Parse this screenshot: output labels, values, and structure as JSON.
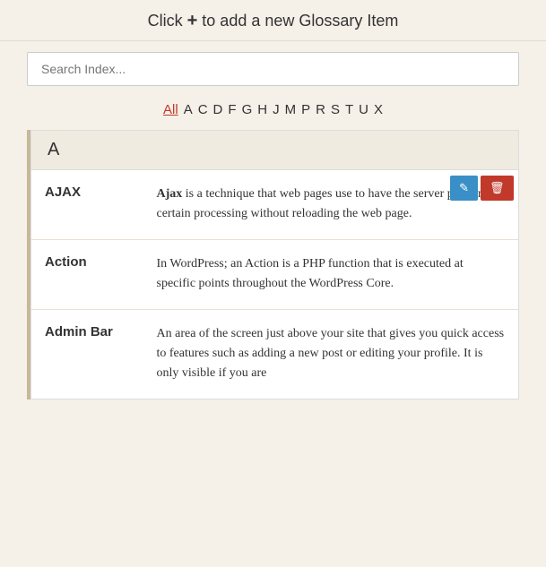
{
  "header": {
    "title_prefix": "Click",
    "title_plus": "+",
    "title_suffix": " to add a new Glossary Item"
  },
  "search": {
    "placeholder": "Search Index..."
  },
  "alphabet": {
    "items": [
      {
        "label": "All",
        "active": true
      },
      {
        "label": "A",
        "active": false
      },
      {
        "label": "C",
        "active": false
      },
      {
        "label": "D",
        "active": false
      },
      {
        "label": "F",
        "active": false
      },
      {
        "label": "G",
        "active": false
      },
      {
        "label": "H",
        "active": false
      },
      {
        "label": "J",
        "active": false
      },
      {
        "label": "M",
        "active": false
      },
      {
        "label": "P",
        "active": false
      },
      {
        "label": "R",
        "active": false
      },
      {
        "label": "S",
        "active": false
      },
      {
        "label": "T",
        "active": false
      },
      {
        "label": "U",
        "active": false
      },
      {
        "label": "X",
        "active": false
      }
    ]
  },
  "glossary": {
    "sections": [
      {
        "letter": "A",
        "entries": [
          {
            "term": "AJAX",
            "definition_bold": "Ajax",
            "definition_rest": " is a technique that web pages use to have the server perform certain processing without reloading the web page."
          },
          {
            "term": "Action",
            "definition_bold": "",
            "definition_rest": "In WordPress; an Action is a PHP function that is executed at specific points throughout the WordPress Core."
          },
          {
            "term": "Admin Bar",
            "definition_bold": "",
            "definition_rest": "An area of the screen just above your site that gives you quick access to features such as adding a new post or editing your profile. It is only visible if you are"
          }
        ]
      }
    ]
  },
  "buttons": {
    "edit_label": "✏",
    "delete_label": "🗑"
  }
}
